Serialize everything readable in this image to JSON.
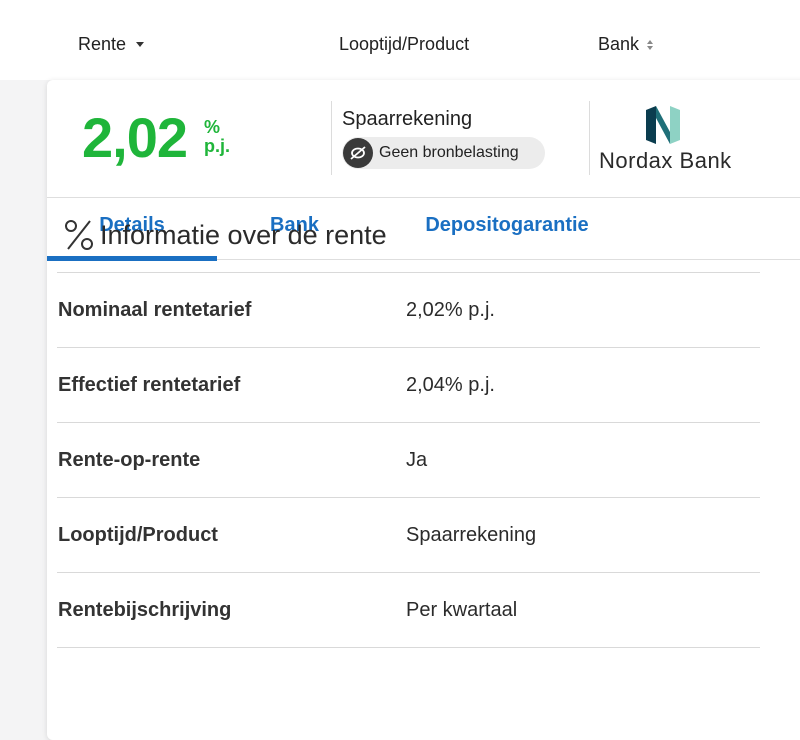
{
  "columns": {
    "rente": "Rente",
    "looptijd": "Looptijd/Product",
    "bank": "Bank"
  },
  "offer": {
    "rate": "2,02",
    "rate_unit_top": "%",
    "rate_unit_bottom": "p.j.",
    "rate_color": "#1fb53a",
    "product": "Spaarrekening",
    "tax_badge": "Geen bronbelasting",
    "bank_name": "Nordax Bank"
  },
  "tabs": [
    {
      "label": "Details",
      "active": true
    },
    {
      "label": "Bank",
      "active": false
    },
    {
      "label": "Depositogarantie",
      "active": false
    }
  ],
  "accent_color": "#1a6fc2",
  "section": {
    "icon": "percent-icon",
    "title": "Informatie over de rente"
  },
  "rows": [
    {
      "label": "Nominaal rentetarief",
      "value": "2,02% p.j."
    },
    {
      "label": "Effectief rentetarief",
      "value": "2,04% p.j."
    },
    {
      "label": "Rente-op-rente",
      "value": "Ja"
    },
    {
      "label": "Looptijd/Product",
      "value": "Spaarrekening"
    },
    {
      "label": "Rentebijschrijving",
      "value": "Per kwartaal"
    }
  ]
}
